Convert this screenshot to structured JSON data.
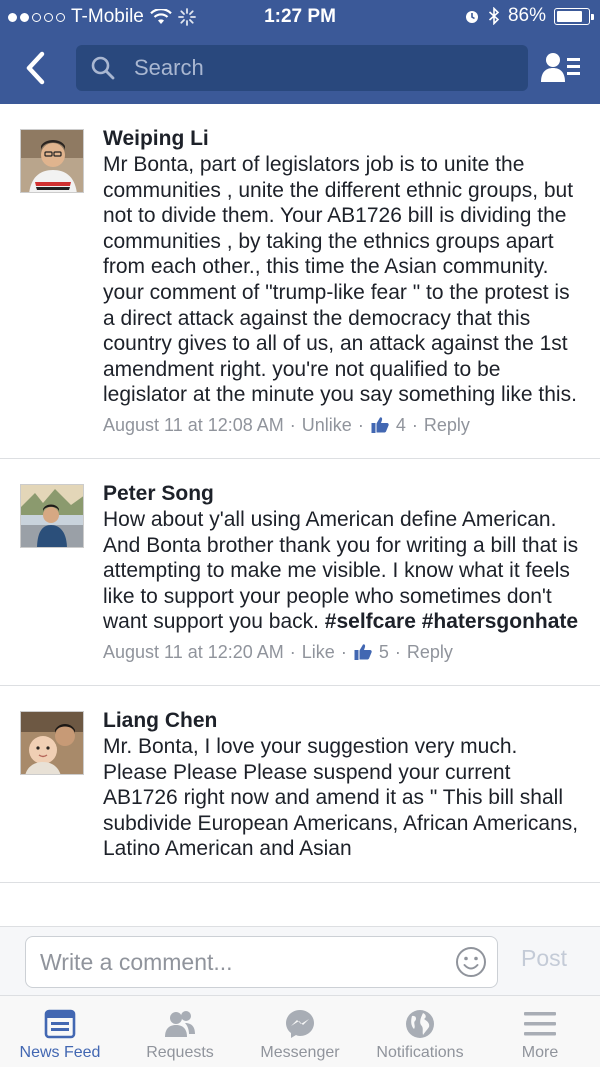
{
  "status_bar": {
    "carrier": "T-Mobile",
    "time": "1:27 PM",
    "battery_percent": "86%",
    "battery_level": 0.86
  },
  "nav": {
    "search_placeholder": "Search",
    "back_icon": "chevron-left-icon",
    "friends_icon": "friend-requests-icon"
  },
  "comments": [
    {
      "author": "Weiping Li",
      "text": "Mr Bonta, part of legislators job is to unite the communities , unite the different ethnic groups, but not to divide them. Your AB1726 bill is dividing the communities , by taking the ethnics groups apart from each other., this time the Asian community. your comment of \"trump-like fear \" to the protest is a direct attack against the democracy that this country gives to all of us, an attack against the 1st amendment right. you're not qualified to be legislator at the minute you say something like this.",
      "hashtags": "",
      "timestamp": "August 11 at 12:08 AM",
      "like_action": "Unlike",
      "like_count": "4",
      "reply": "Reply",
      "liked": true
    },
    {
      "author": "Peter Song",
      "text": "How about y'all using American define American. And Bonta brother thank you for writing a bill that is attempting to make me visible. I know what it feels like to support your people who sometimes don't want support you back. ",
      "hashtags": "#selfcare #hatersgonhate",
      "timestamp": "August 11 at 12:20 AM",
      "like_action": "Like",
      "like_count": "5",
      "reply": "Reply",
      "liked": false
    },
    {
      "author": "Liang Chen",
      "text": "Mr. Bonta, I love your suggestion very much. Please Please Please suspend your current AB1726 right now and amend it as \" This bill shall subdivide European Americans, African Americans, Latino American and Asian",
      "hashtags": "",
      "timestamp": "",
      "like_action": "",
      "like_count": "",
      "reply": "",
      "liked": false
    }
  ],
  "composer": {
    "placeholder": "Write a comment...",
    "post_label": "Post"
  },
  "tabs": [
    {
      "label": "News Feed",
      "icon": "news-feed-icon",
      "active": true
    },
    {
      "label": "Requests",
      "icon": "requests-icon",
      "active": false
    },
    {
      "label": "Messenger",
      "icon": "messenger-icon",
      "active": false
    },
    {
      "label": "Notifications",
      "icon": "globe-icon",
      "active": false
    },
    {
      "label": "More",
      "icon": "menu-icon",
      "active": false
    }
  ],
  "colors": {
    "brand_blue": "#3b5998",
    "search_bg": "#29487d",
    "active_tab": "#4267b2",
    "meta_gray": "#90949c"
  }
}
